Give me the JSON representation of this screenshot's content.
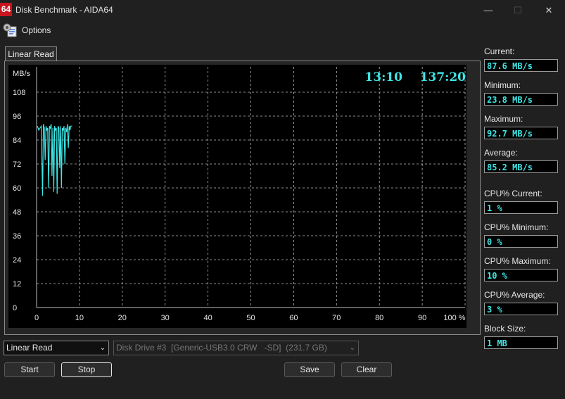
{
  "window": {
    "title": "Disk Benchmark - AIDA64",
    "logo_text": "64"
  },
  "menu": {
    "options_label": "Options"
  },
  "tabs": [
    {
      "label": "Linear Read"
    }
  ],
  "chart_data": {
    "type": "line",
    "ylabel": "MB/s",
    "xlabel": "",
    "ylim": [
      0,
      108
    ],
    "xlim": [
      0,
      100
    ],
    "y_ticks": [
      "0",
      "12",
      "24",
      "36",
      "48",
      "60",
      "72",
      "84",
      "96",
      "108"
    ],
    "x_ticks": [
      "0",
      "10",
      "20",
      "30",
      "40",
      "50",
      "60",
      "70",
      "80",
      "90",
      "100 %"
    ],
    "grid": true,
    "elapsed_time": "13:10",
    "remaining_time": "137:20",
    "colors": {
      "line": "#3fe6e6",
      "grid": "#bbbbbb",
      "background": "#000000",
      "time_text": "#3fe6e6"
    },
    "series": [
      {
        "x": [
          0.2,
          0.5,
          0.8,
          1.1,
          1.4,
          1.6,
          1.8,
          2.0,
          2.2,
          2.4,
          2.6,
          2.8,
          3.0,
          3.2,
          3.4,
          3.6,
          3.8,
          4.0,
          4.2,
          4.4,
          4.6,
          4.8,
          5.0,
          5.2,
          5.4,
          5.6,
          5.8,
          6.0,
          6.2,
          6.4,
          6.6,
          6.8,
          7.0,
          7.2,
          7.4,
          7.6,
          7.8,
          8.0,
          8.3
        ],
        "y": [
          91,
          89,
          90,
          91,
          56,
          92,
          90,
          74,
          91,
          89,
          90,
          60,
          91,
          90,
          92,
          66,
          90,
          58,
          91,
          89,
          90,
          57,
          91,
          90,
          70,
          91,
          60,
          90,
          89,
          91,
          72,
          90,
          88,
          92,
          80,
          91,
          89,
          91,
          91
        ]
      }
    ]
  },
  "stats": [
    {
      "label": "Current:",
      "value": "87.6 MB/s"
    },
    {
      "label": "Minimum:",
      "value": "23.8 MB/s"
    },
    {
      "label": "Maximum:",
      "value": "92.7 MB/s"
    },
    {
      "label": "Average:",
      "value": "85.2 MB/s"
    },
    {
      "label": "CPU% Current:",
      "value": "1 %"
    },
    {
      "label": "CPU% Minimum:",
      "value": "0 %"
    },
    {
      "label": "CPU% Maximum:",
      "value": "10 %"
    },
    {
      "label": "CPU% Average:",
      "value": "3 %"
    },
    {
      "label": "Block Size:",
      "value": "1 MB"
    }
  ],
  "controls": {
    "mode_value": "Linear Read",
    "drive_value": "Disk Drive #3  [Generic-USB3.0 CRW   -SD]  (231.7 GB)",
    "start_label": "Start",
    "stop_label": "Stop",
    "save_label": "Save",
    "clear_label": "Clear"
  }
}
